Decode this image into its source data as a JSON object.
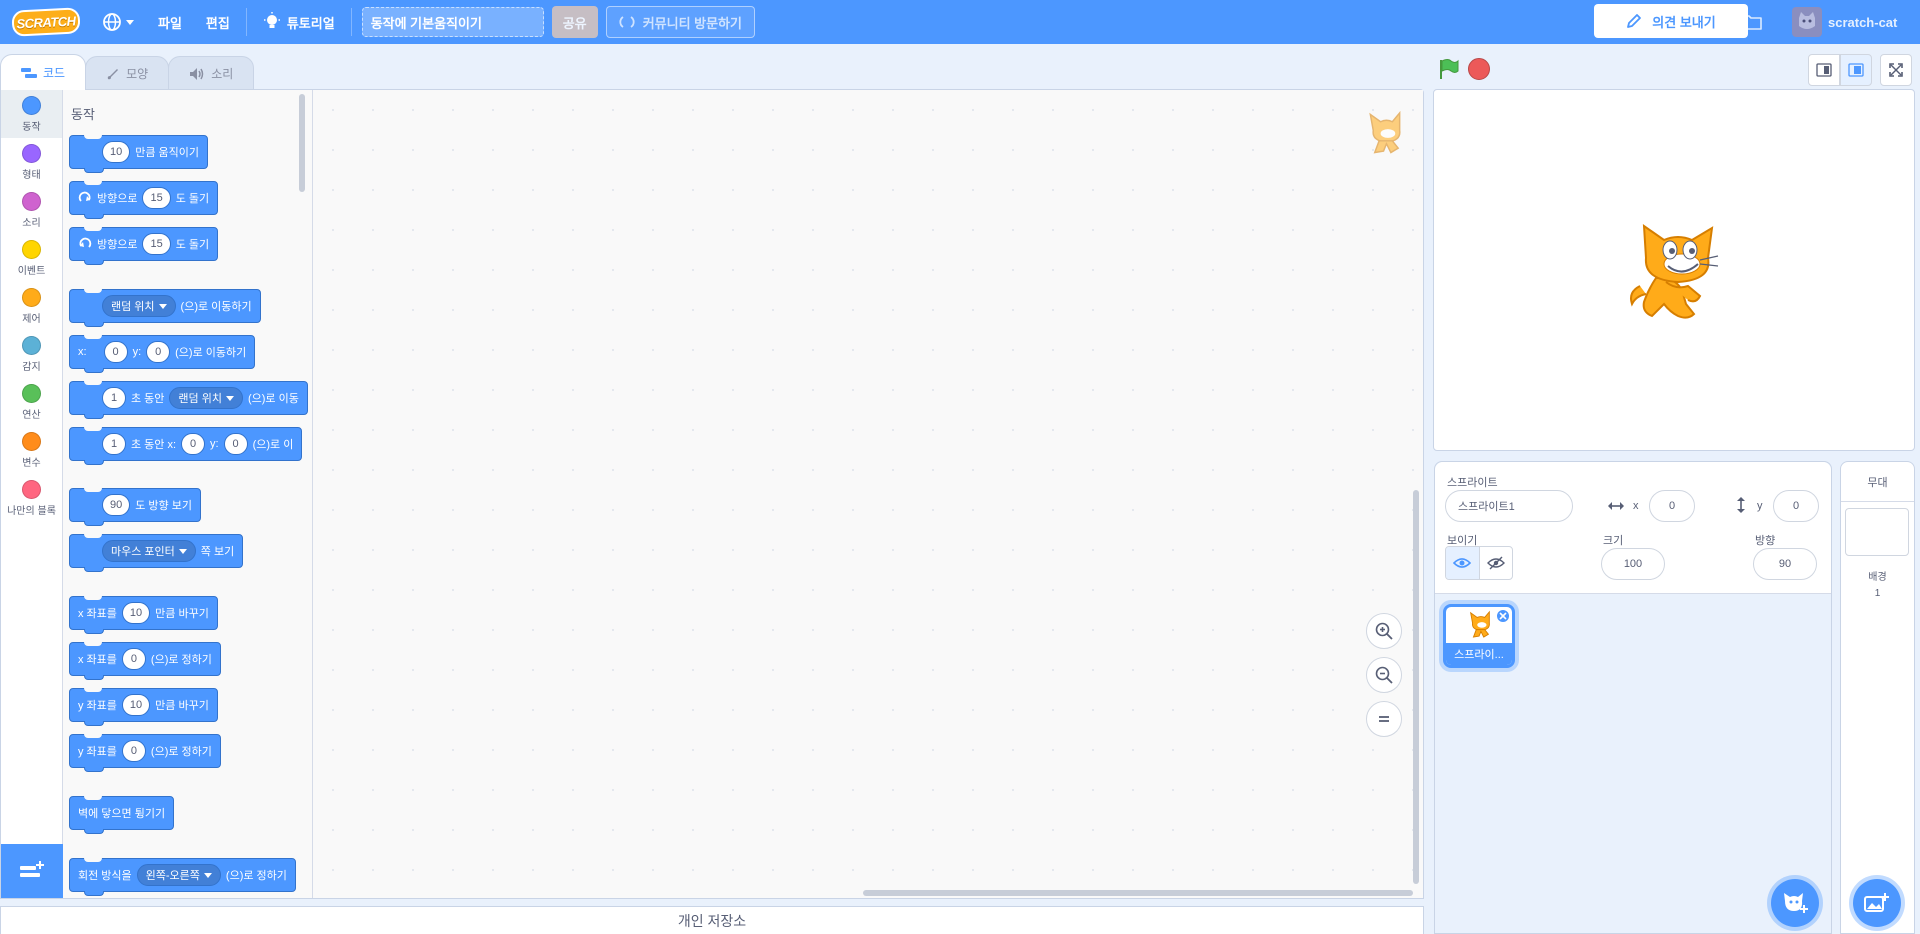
{
  "menubar": {
    "logo_text": "SCRATCH",
    "file_label": "파일",
    "edit_label": "편집",
    "tutorials_label": "튜토리얼",
    "project_title": "동작에 기본움직이기",
    "share_label": "공유",
    "community_label": "커뮤니티 방문하기",
    "feedback_label": "의견 보내기",
    "username": "scratch-cat"
  },
  "tabs": [
    {
      "label": "코드"
    },
    {
      "label": "모양"
    },
    {
      "label": "소리"
    }
  ],
  "categories": [
    {
      "label": "동작",
      "color": "#4c97ff"
    },
    {
      "label": "형태",
      "color": "#9966ff"
    },
    {
      "label": "소리",
      "color": "#cf63cf"
    },
    {
      "label": "이벤트",
      "color": "#ffd500"
    },
    {
      "label": "제어",
      "color": "#ffab19"
    },
    {
      "label": "감지",
      "color": "#5cb1d6"
    },
    {
      "label": "연산",
      "color": "#59c059"
    },
    {
      "label": "변수",
      "color": "#ff8c1a"
    },
    {
      "label": "나만의 블록",
      "color": "#ff6680"
    }
  ],
  "palette": {
    "title": "동작",
    "blocks": {
      "move": {
        "value": "10",
        "text": "만큼 움직이기"
      },
      "turn_right": {
        "text1": "방향으로",
        "value": "15",
        "text2": "도 돌기"
      },
      "turn_left": {
        "text1": "방향으로",
        "value": "15",
        "text2": "도 돌기"
      },
      "goto": {
        "dropdown": "랜덤 위치",
        "text": "(으)로 이동하기"
      },
      "goto_xy": {
        "x_label": "x:",
        "x": "0",
        "y_label": "y:",
        "y": "0",
        "text": "(으)로 이동하기"
      },
      "glide": {
        "value": "1",
        "text1": "초 동안",
        "dropdown": "랜덤 위치",
        "text2": "(으)로 이동"
      },
      "glide_xy": {
        "value": "1",
        "text1": "초 동안 x:",
        "x": "0",
        "y_label": "y:",
        "y": "0",
        "text2": "(으)로 이"
      },
      "point_dir": {
        "value": "90",
        "text": "도 방향 보기"
      },
      "point_towards": {
        "dropdown": "마우스 포인터",
        "text": "쪽 보기"
      },
      "change_x": {
        "text1": "x 좌표를",
        "value": "10",
        "text2": "만큼 바꾸기"
      },
      "set_x": {
        "text1": "x 좌표를",
        "value": "0",
        "text2": "(으)로 정하기"
      },
      "change_y": {
        "text1": "y 좌표를",
        "value": "10",
        "text2": "만큼 바꾸기"
      },
      "set_y": {
        "text1": "y 좌표를",
        "value": "0",
        "text2": "(으)로 정하기"
      },
      "bounce": {
        "text": "벽에 닿으면 튕기기"
      },
      "rotation_style": {
        "text1": "회전 방식을",
        "dropdown": "왼쪽-오른쪽",
        "text2": "(으)로 정하기"
      }
    }
  },
  "backpack_label": "개인 저장소",
  "sprite_info": {
    "sprite_label": "스프라이트",
    "sprite_name": "스프라이트1",
    "x_label": "x",
    "x": "0",
    "y_label": "y",
    "y": "0",
    "show_label": "보이기",
    "size_label": "크기",
    "size": "100",
    "direction_label": "방향",
    "direction": "90"
  },
  "sprite_tile": {
    "name": "스프라이..."
  },
  "stage_panel": {
    "title": "무대",
    "backdrops_label": "배경",
    "backdrops_count": "1"
  }
}
